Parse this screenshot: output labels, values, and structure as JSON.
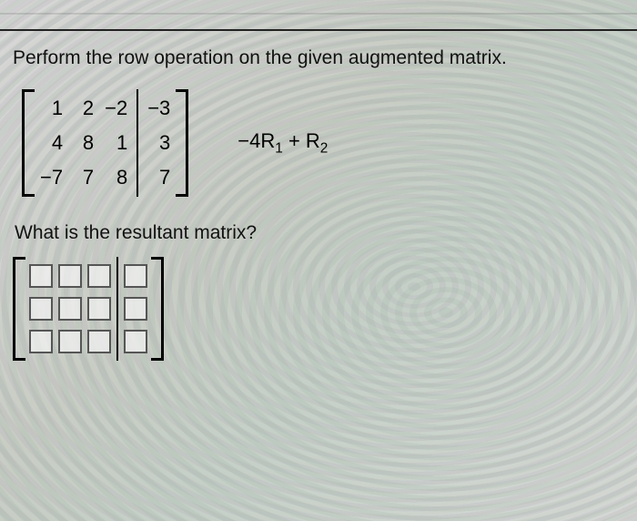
{
  "instruction": "Perform the row operation on the given augmented matrix.",
  "matrix": {
    "left_cols": [
      [
        "1",
        "4",
        "−7"
      ],
      [
        "2",
        "8",
        "7"
      ],
      [
        "−2",
        "1",
        "8"
      ]
    ],
    "right_col": [
      "−3",
      "3",
      "7"
    ]
  },
  "operation": {
    "prefix": "−4R",
    "sub1": "1",
    "mid": " + R",
    "sub2": "2"
  },
  "question": "What is the resultant matrix?",
  "answer_grid": {
    "left_cols": 3,
    "right_cols": 1,
    "rows": 3
  }
}
